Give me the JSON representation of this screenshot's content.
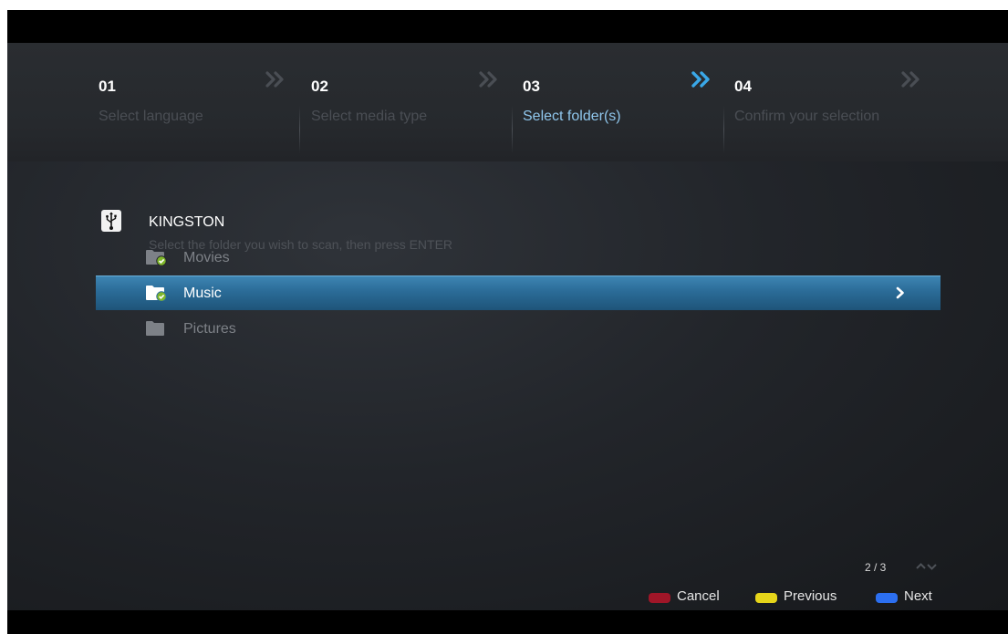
{
  "steps": [
    {
      "num": "01",
      "label": "Select language",
      "active": false
    },
    {
      "num": "02",
      "label": "Select media type",
      "active": false
    },
    {
      "num": "03",
      "label": "Select folder(s)",
      "active": true
    },
    {
      "num": "04",
      "label": "Confirm your selection",
      "active": false
    }
  ],
  "device": {
    "name": "KINGSTON",
    "icon": "usb-icon",
    "hint": "Select the folder you wish to scan, then press ENTER"
  },
  "folders": [
    {
      "label": "Movies",
      "checked": true,
      "selected": false
    },
    {
      "label": "Music",
      "checked": true,
      "selected": true
    },
    {
      "label": "Pictures",
      "checked": false,
      "selected": false
    }
  ],
  "pager": {
    "text": "2 / 3"
  },
  "legend": {
    "cancel": {
      "label": "Cancel",
      "color": "#a01628"
    },
    "previous": {
      "label": "Previous",
      "color": "#e6d51a"
    },
    "next": {
      "label": "Next",
      "color": "#2c6ff0"
    }
  },
  "colors": {
    "accent": "#8fc6ec",
    "selected_row": "#2b6c98",
    "check_green": "#7fb72a"
  }
}
